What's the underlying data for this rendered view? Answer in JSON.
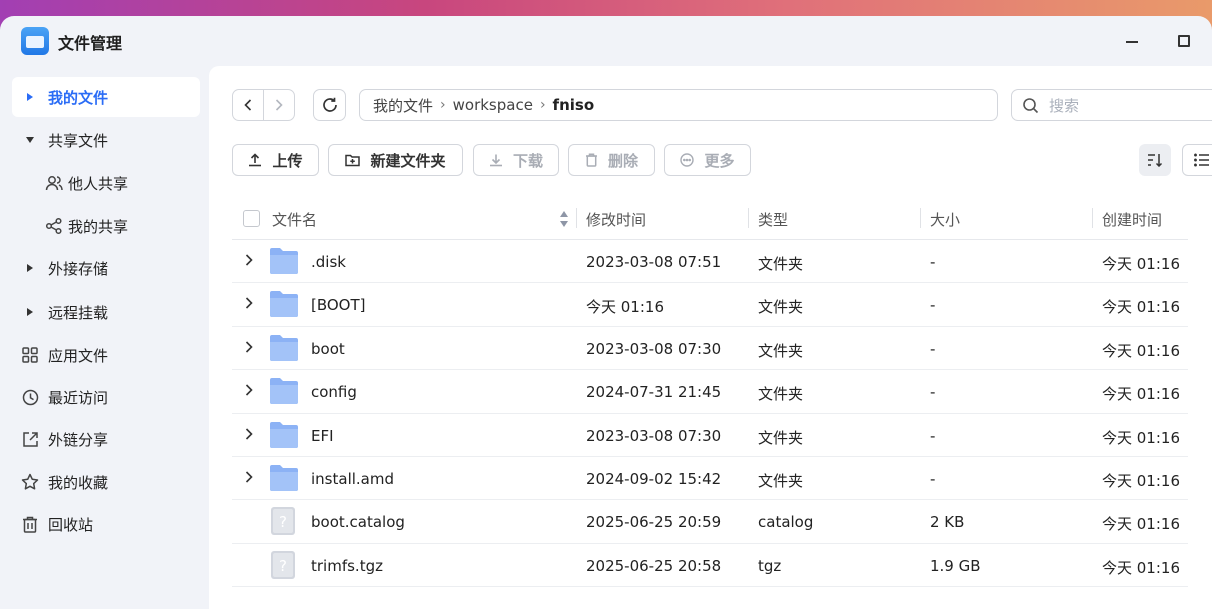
{
  "app": {
    "title": "文件管理"
  },
  "sidebar": {
    "items": [
      {
        "label": "我的文件"
      },
      {
        "label": "共享文件"
      },
      {
        "label": "他人共享"
      },
      {
        "label": "我的共享"
      },
      {
        "label": "外接存储"
      },
      {
        "label": "远程挂载"
      },
      {
        "label": "应用文件"
      },
      {
        "label": "最近访问"
      },
      {
        "label": "外链分享"
      },
      {
        "label": "我的收藏"
      },
      {
        "label": "回收站"
      }
    ]
  },
  "breadcrumb": {
    "root": "我的文件",
    "p1": "workspace",
    "current": "fniso"
  },
  "search": {
    "placeholder": "搜索"
  },
  "toolbar": {
    "upload": "上传",
    "new_folder": "新建文件夹",
    "download": "下载",
    "delete": "删除",
    "more": "更多"
  },
  "table": {
    "headers": {
      "name": "文件名",
      "modified": "修改时间",
      "type": "类型",
      "size": "大小",
      "created": "创建时间"
    },
    "rows": [
      {
        "name": ".disk",
        "modified": "2023-03-08 07:51",
        "type": "文件夹",
        "size": "-",
        "created": "今天 01:16",
        "kind": "folder"
      },
      {
        "name": "[BOOT]",
        "modified": "今天 01:16",
        "type": "文件夹",
        "size": "-",
        "created": "今天 01:16",
        "kind": "folder"
      },
      {
        "name": "boot",
        "modified": "2023-03-08 07:30",
        "type": "文件夹",
        "size": "-",
        "created": "今天 01:16",
        "kind": "folder"
      },
      {
        "name": "config",
        "modified": "2024-07-31 21:45",
        "type": "文件夹",
        "size": "-",
        "created": "今天 01:16",
        "kind": "folder"
      },
      {
        "name": "EFI",
        "modified": "2023-03-08 07:30",
        "type": "文件夹",
        "size": "-",
        "created": "今天 01:16",
        "kind": "folder"
      },
      {
        "name": "install.amd",
        "modified": "2024-09-02 15:42",
        "type": "文件夹",
        "size": "-",
        "created": "今天 01:16",
        "kind": "folder"
      },
      {
        "name": "boot.catalog",
        "modified": "2025-06-25 20:59",
        "type": "catalog",
        "size": "2 KB",
        "created": "今天 01:16",
        "kind": "file"
      },
      {
        "name": "trimfs.tgz",
        "modified": "2025-06-25 20:58",
        "type": "tgz",
        "size": "1.9 GB",
        "created": "今天 01:16",
        "kind": "file"
      }
    ]
  },
  "colors": {
    "accent": "#2a6cf6",
    "folder": "#8cb2f5",
    "active_bg": "#ffffff"
  }
}
